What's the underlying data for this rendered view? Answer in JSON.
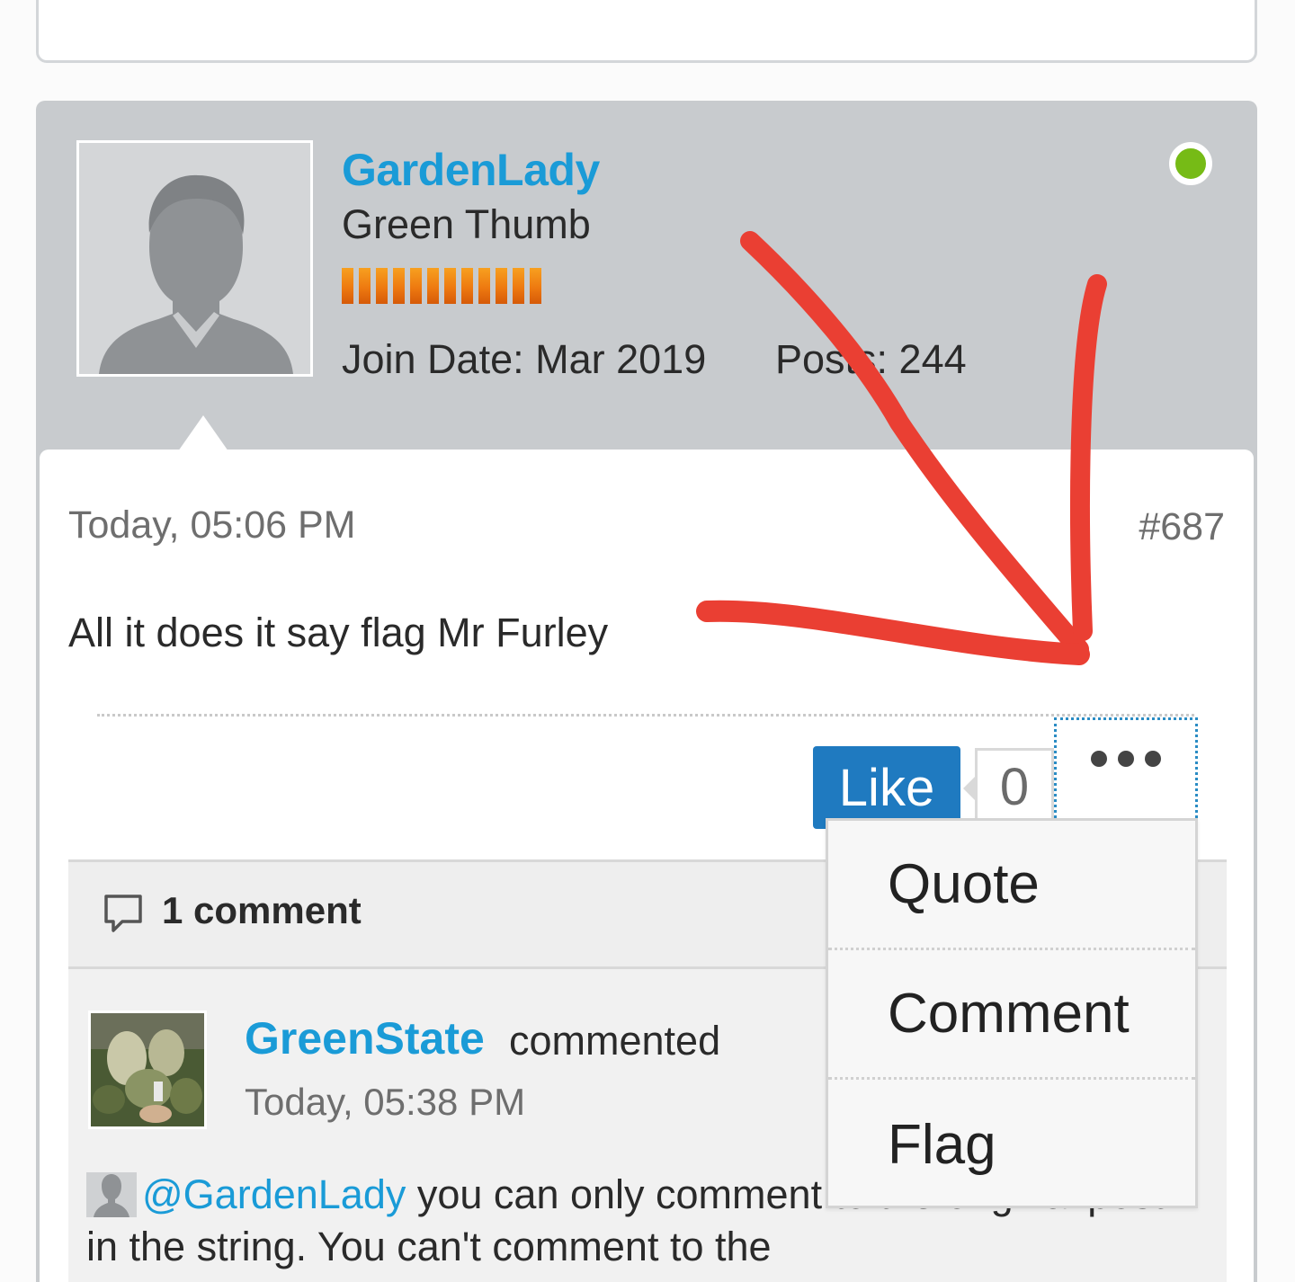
{
  "post": {
    "username": "GardenLady",
    "user_title": "Green Thumb",
    "join_date": "Join Date: Mar 2019",
    "posts": "Posts: 244",
    "date": "Today, 05:06 PM",
    "number": "#687",
    "text": "All it does it say flag Mr Furley"
  },
  "actions": {
    "like_label": "Like",
    "like_count": "0"
  },
  "comments": {
    "count_label": "1 comment",
    "items": [
      {
        "author": "GreenState",
        "verb": "commented",
        "date": "Today, 05:38 PM",
        "mention": "@GardenLady",
        "text": " you can only comment to the original post in the string. You can't comment to the"
      }
    ]
  },
  "menu": {
    "items": [
      "Quote",
      "Comment",
      "Flag"
    ]
  },
  "colors": {
    "link": "#1a9bd7",
    "like_button": "#1f7ac0",
    "online": "#76bb16",
    "annotation": "#ea3f33"
  }
}
